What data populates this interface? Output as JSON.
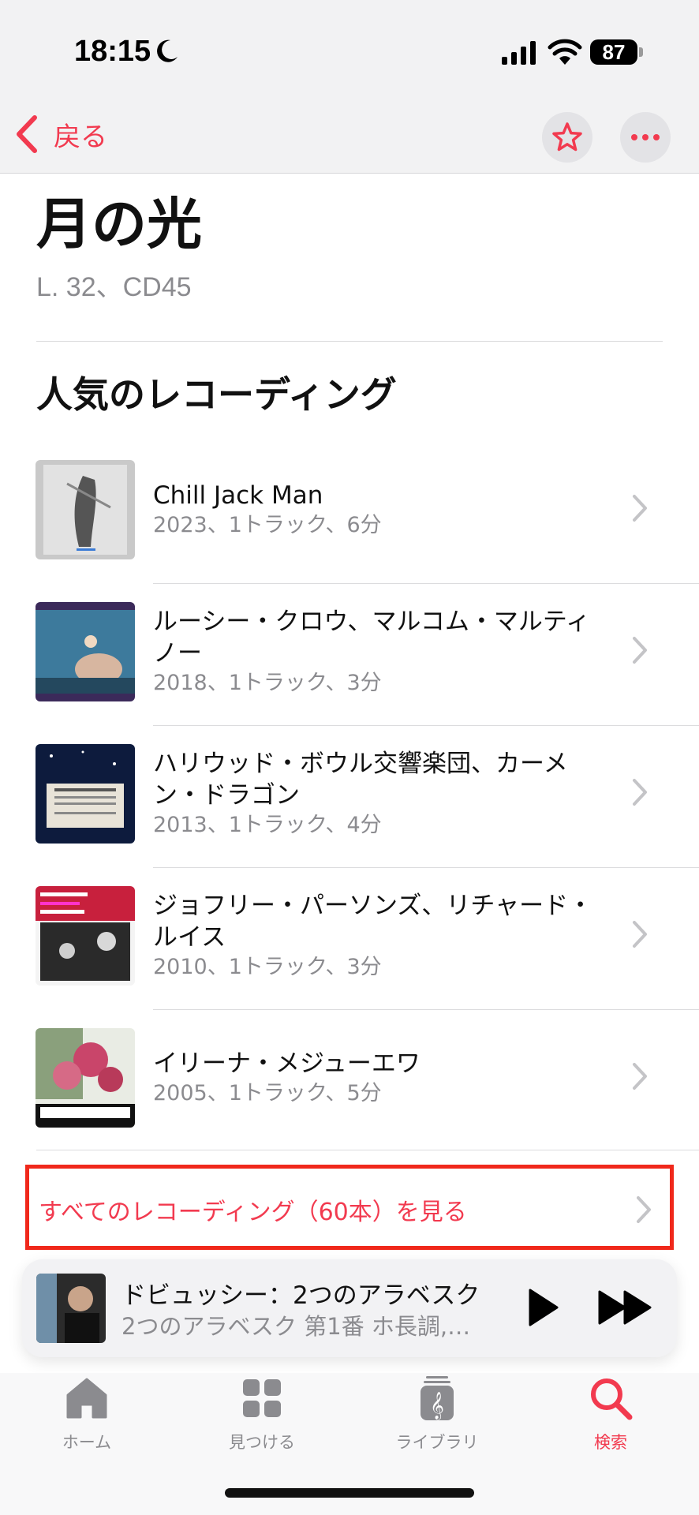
{
  "status_bar": {
    "time": "18:15",
    "battery": "87"
  },
  "nav": {
    "back_label": "戻る"
  },
  "work": {
    "title": "月の光",
    "catalog": "L. 32、CD45"
  },
  "section": {
    "heading": "人気のレコーディング"
  },
  "recordings": [
    {
      "name": "Chill Jack Man",
      "meta": "2023、1トラック、6分"
    },
    {
      "name": "ルーシー・クロウ、マルコム・マルティノー",
      "meta": "2018、1トラック、3分"
    },
    {
      "name": "ハリウッド・ボウル交響楽団、カーメン・ドラゴン",
      "meta": "2013、1トラック、4分"
    },
    {
      "name": "ジョフリー・パーソンズ、リチャード・ルイス",
      "meta": "2010、1トラック、3分"
    },
    {
      "name": "イリーナ・メジューエワ",
      "meta": "2005、1トラック、5分"
    }
  ],
  "see_all": {
    "label": "すべてのレコーディング（60本）を見る"
  },
  "now_playing": {
    "title": "ドビュッシー：2つのアラベスク",
    "subtitle": "2つのアラベスク 第1番 ホ長調,…"
  },
  "tabs": [
    {
      "label": "ホーム",
      "icon": "home-icon",
      "active": false
    },
    {
      "label": "見つける",
      "icon": "grid-icon",
      "active": false
    },
    {
      "label": "ライブラリ",
      "icon": "library-icon",
      "active": false
    },
    {
      "label": "検索",
      "icon": "search-icon",
      "active": true
    }
  ],
  "colors": {
    "accent": "#f23a4f",
    "highlight_box": "#f0281b",
    "secondary_text": "#8b8b8f"
  }
}
